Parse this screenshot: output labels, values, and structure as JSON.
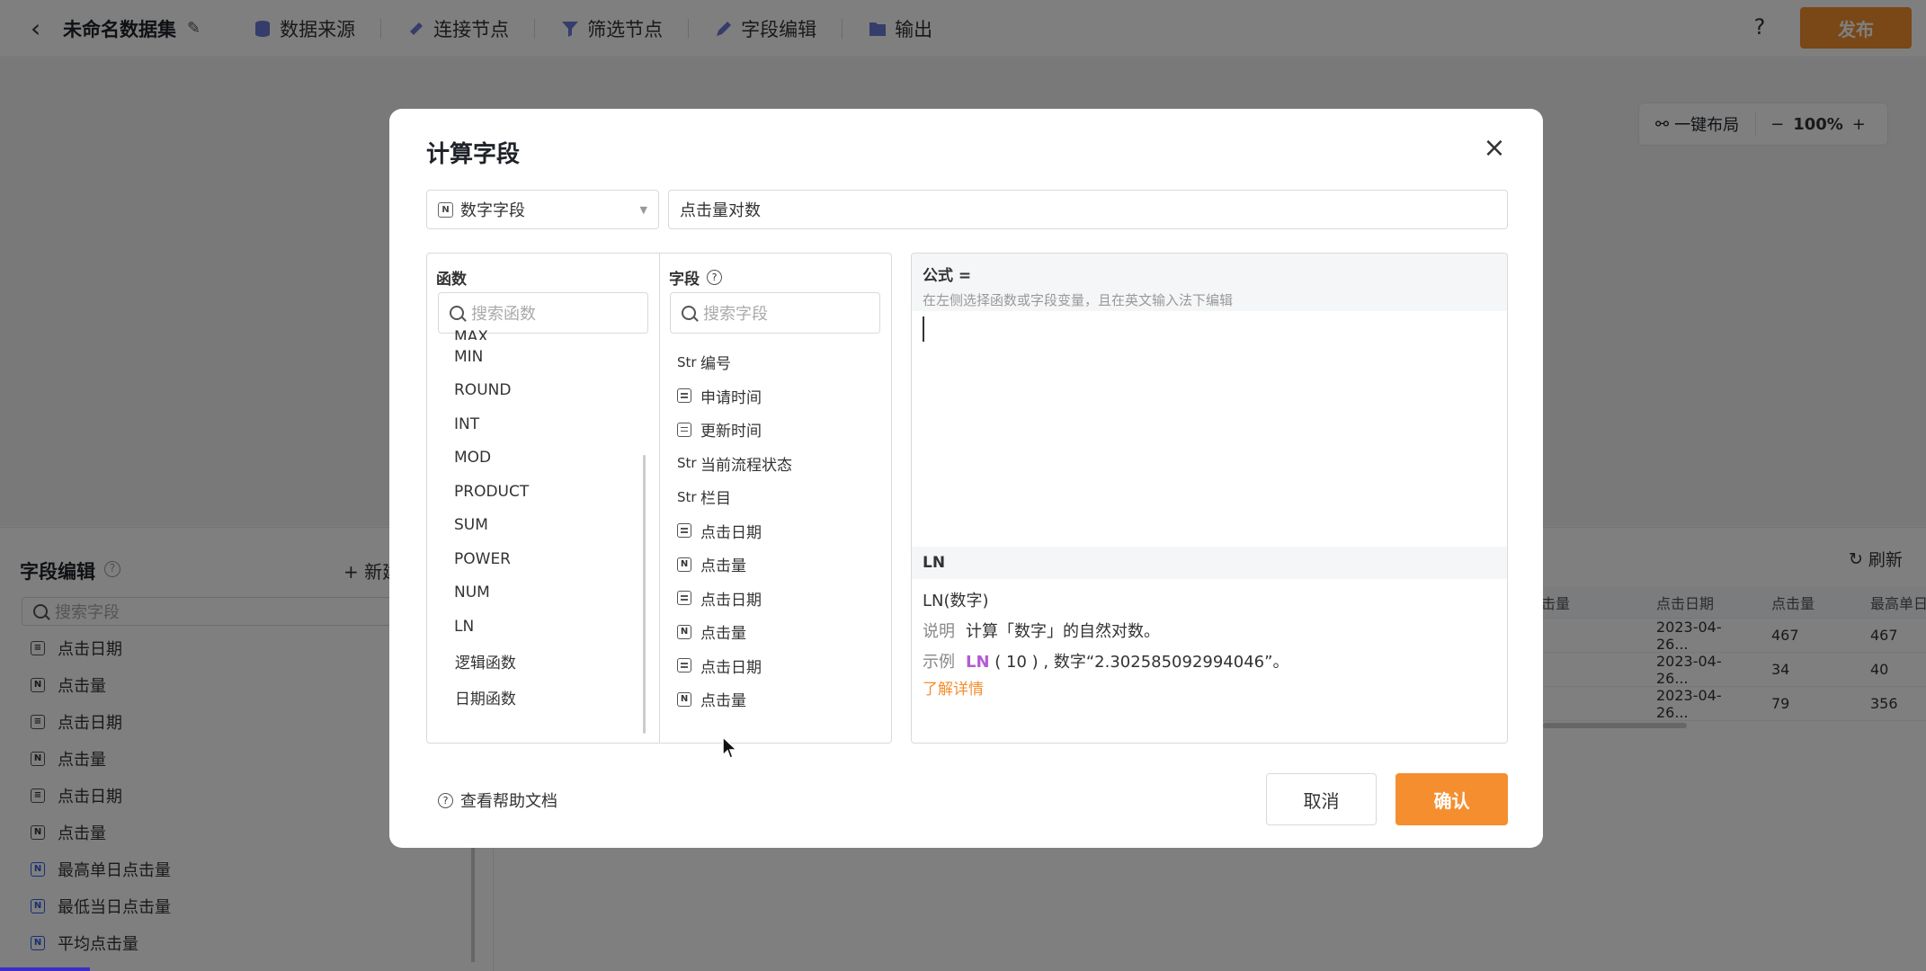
{
  "app": {
    "dataset_name": "未命名数据集",
    "nav": [
      {
        "label": "数据来源"
      },
      {
        "label": "连接节点"
      },
      {
        "label": "筛选节点"
      },
      {
        "label": "字段编辑"
      },
      {
        "label": "输出"
      }
    ],
    "help": "?",
    "publish": "发布",
    "layout_button": "一键布局",
    "zoom": "100%",
    "zoom_minus": "−",
    "zoom_plus": "+"
  },
  "field_editor": {
    "title": "字段编辑",
    "new_label": "+ 新建",
    "search_placeholder": "搜索字段",
    "items": [
      {
        "type": "date",
        "name": "点击日期"
      },
      {
        "type": "num",
        "name": "点击量"
      },
      {
        "type": "date",
        "name": "点击日期"
      },
      {
        "type": "num",
        "name": "点击量"
      },
      {
        "type": "date",
        "name": "点击日期"
      },
      {
        "type": "num",
        "name": "点击量"
      },
      {
        "type": "num-new",
        "name": "最高单日点击量"
      },
      {
        "type": "num-new",
        "name": "最低当日点击量"
      },
      {
        "type": "num-new",
        "name": "平均点击量"
      }
    ]
  },
  "preview": {
    "refresh": "刷新",
    "headers": [
      "击量",
      "点击日期",
      "点击量",
      "最高单日"
    ],
    "rows": [
      [
        "",
        "2023-04-26...",
        "467",
        "467"
      ],
      [
        "",
        "2023-04-26...",
        "34",
        "40"
      ],
      [
        "",
        "2023-04-26...",
        "79",
        "356"
      ]
    ]
  },
  "dialog": {
    "title": "计算字段",
    "close": "×",
    "type_select": "数字字段",
    "type_badge": "N",
    "field_name": "点击量对数",
    "functions_header": "函数",
    "functions_search_placeholder": "搜索函数",
    "functions": [
      "MAX",
      "MIN",
      "ROUND",
      "INT",
      "MOD",
      "PRODUCT",
      "SUM",
      "POWER",
      "NUM",
      "LN"
    ],
    "function_groups": [
      "逻辑函数",
      "日期函数"
    ],
    "fields_header": "字段",
    "fields_search_placeholder": "搜索字段",
    "fields": [
      {
        "type": "Str",
        "name": "编号"
      },
      {
        "type": "date",
        "name": "申请时间"
      },
      {
        "type": "date",
        "name": "更新时间"
      },
      {
        "type": "Str",
        "name": "当前流程状态"
      },
      {
        "type": "Str",
        "name": "栏目"
      },
      {
        "type": "date",
        "name": "点击日期"
      },
      {
        "type": "num",
        "name": "点击量"
      },
      {
        "type": "date",
        "name": "点击日期"
      },
      {
        "type": "num",
        "name": "点击量"
      },
      {
        "type": "date",
        "name": "点击日期"
      },
      {
        "type": "num",
        "name": "点击量"
      }
    ],
    "formula_label": "公式 =",
    "formula_hint": "在左侧选择函数或字段变量，且在英文输入法下编辑",
    "doc": {
      "function": "LN",
      "signature": "LN(数字)",
      "desc_label": "说明",
      "desc": "计算「数字」的自然对数。",
      "example_label": "示例",
      "example_kw": "LN",
      "example_rest": "( 10 ) , 数字“2.302585092994046”。",
      "more": "了解详情"
    },
    "help_doc": "查看帮助文档",
    "cancel": "取消",
    "confirm": "确认"
  }
}
